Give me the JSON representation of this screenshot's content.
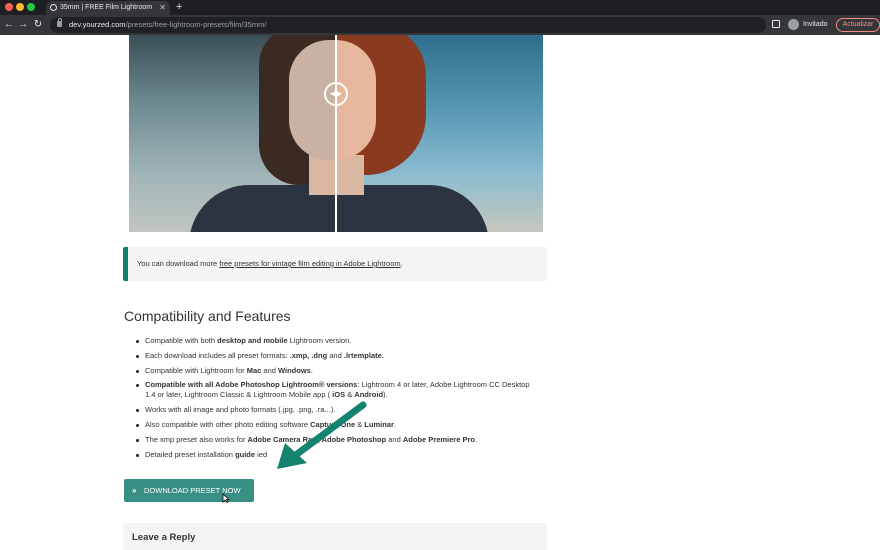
{
  "browser": {
    "tab_title": "35mm | FREE Film Lightroom",
    "tab_close": "✕",
    "new_tab": "+",
    "back": "←",
    "forward": "→",
    "reload": "↻",
    "url_host": "dev.yourzed.com",
    "url_path": "/presets/free-lightroom-presets/film/35mm/",
    "profile_label": "Invitado",
    "update_button": "Actualizar",
    "traffic_colors": [
      "#ff5f57",
      "#febc2e",
      "#28c840"
    ]
  },
  "hero": {
    "handle_icon": "◀▶"
  },
  "note": {
    "prefix": "You can download more ",
    "link": "free presets for vintage film editing in Adobe Lightroom",
    "suffix": "."
  },
  "section_title": "Compatibility and Features",
  "features": [
    [
      {
        "t": "Compatible with both "
      },
      {
        "b": "desktop and mobile"
      },
      {
        "t": " Lightroom version."
      }
    ],
    [
      {
        "t": "Each download includes all preset formats: "
      },
      {
        "b": ".xmp, .dng"
      },
      {
        "t": " and "
      },
      {
        "b": ".lrtemplate."
      }
    ],
    [
      {
        "t": "Compatible with Lightroom for "
      },
      {
        "b": "Mac"
      },
      {
        "t": " and "
      },
      {
        "b": "Windows"
      },
      {
        "t": "."
      }
    ],
    [
      {
        "b": "Compatible with all Adobe Photoshop Lightroom® versions"
      },
      {
        "t": ": Lightroom 4 or later, Adobe Lightroom CC Desktop 1.4 or later, Lightroom Classic & Lightroom Mobile app ("
      },
      {
        "b": " iOS"
      },
      {
        "t": " & "
      },
      {
        "b": "Android"
      },
      {
        "t": ")."
      }
    ],
    [
      {
        "t": "Works with all image and photo formats (.jpg, .png, .ra"
      },
      {
        "t": "...)."
      }
    ],
    [
      {
        "t": "Also compatible with other photo editing software"
      },
      {
        "t": " "
      },
      {
        "b": "Capture One"
      },
      {
        "t": " & "
      },
      {
        "b": "Luminar"
      },
      {
        "t": "."
      }
    ],
    [
      {
        "t": "The xmp preset also works for "
      },
      {
        "b": "Adobe Camera Raw, Adobe Photoshop"
      },
      {
        "t": " and "
      },
      {
        "b": "Adobe Premiere Pro"
      },
      {
        "t": "."
      }
    ],
    [
      {
        "t": "Detailed preset installation "
      },
      {
        "b": "guide"
      },
      {
        "t": " i"
      },
      {
        "t": "ed"
      }
    ]
  ],
  "download": {
    "icon": "»",
    "label": "DOWNLOAD PRESET NOW",
    "color": "#3a8f84"
  },
  "arrow_color": "#14836f",
  "reply_title": "Leave a Reply"
}
